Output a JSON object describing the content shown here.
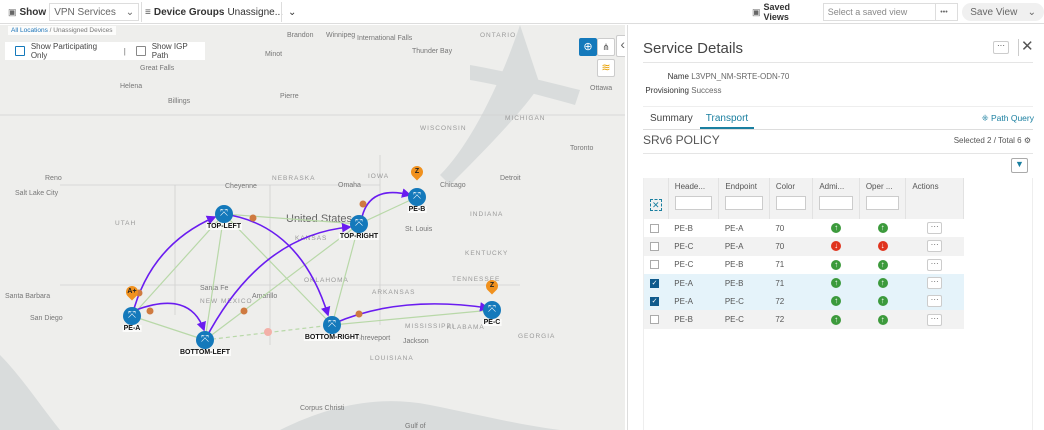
{
  "toolbar": {
    "show_label": "Show",
    "show_value": "VPN Services",
    "device_groups_label": "Device Groups",
    "device_groups_value": "Unassigne...",
    "saved_views_label": "Saved Views",
    "saved_view_placeholder": "Select a saved view",
    "more": "•••",
    "save_view": "Save View"
  },
  "map": {
    "breadcrumb_root": "All Locations",
    "breadcrumb_current": "Unassigned Devices",
    "show_participating": "Show Participating Only",
    "show_igp": "Show IGP Path",
    "country": "United States",
    "labels": [
      "Brandon",
      "Winnipeg",
      "International Falls",
      "Thunder Bay",
      "ONTARIO",
      "Minot",
      "Great Falls",
      "Helena",
      "Billings",
      "Pierre",
      "WISCONSIN",
      "MICHIGAN",
      "Salt Lake City",
      "Cheyenne",
      "Omaha",
      "Chicago",
      "NEBRASKA",
      "IOWA",
      "UTAH",
      "KANSAS",
      "St. Louis",
      "INDIANA",
      "KENTUCKY",
      "TENNESSEE",
      "OKLAHOMA",
      "ARKANSAS",
      "Santa Fe",
      "Amarillo",
      "NEW MEXICO",
      "MISSISSIPPI",
      "ALABAMA",
      "Shreveport",
      "Jackson",
      "LOUISIANA",
      "GEORGIA",
      "Santa Barbara",
      "San Diego",
      "Reno",
      "Corpus Christi",
      "Gulf of",
      "Ottawa",
      "Toronto",
      "Detroit"
    ],
    "nodes": [
      {
        "id": "PE-A"
      },
      {
        "id": "TOP-LEFT"
      },
      {
        "id": "TOP-RIGHT"
      },
      {
        "id": "PE-B"
      },
      {
        "id": "BOTTOM-LEFT"
      },
      {
        "id": "BOTTOM-RIGHT"
      },
      {
        "id": "PE-C"
      }
    ],
    "markers": {
      "a": "A+",
      "z1": "Z",
      "z2": "Z"
    }
  },
  "panel": {
    "title": "Service Details",
    "name_label": "Name",
    "name_value": "L3VPN_NM-SRTE-ODN-70",
    "prov_label": "Provisioning",
    "prov_value": "Success",
    "tabs": [
      "Summary",
      "Transport"
    ],
    "active_tab": "Transport",
    "path_query": "Path Query",
    "section": "SRv6 POLICY",
    "selection": "Selected 2 / Total 6",
    "columns": [
      "Heade...",
      "Endpoint",
      "Color",
      "Admi...",
      "Oper ...",
      "Actions"
    ],
    "rows": [
      {
        "head": "PE-B",
        "end": "PE-A",
        "color": "70",
        "admin": "up",
        "oper": "up",
        "checked": false
      },
      {
        "head": "PE-C",
        "end": "PE-A",
        "color": "70",
        "admin": "down",
        "oper": "down",
        "checked": false
      },
      {
        "head": "PE-C",
        "end": "PE-B",
        "color": "71",
        "admin": "up",
        "oper": "up",
        "checked": false
      },
      {
        "head": "PE-A",
        "end": "PE-B",
        "color": "71",
        "admin": "up",
        "oper": "up",
        "checked": true
      },
      {
        "head": "PE-A",
        "end": "PE-C",
        "color": "72",
        "admin": "up",
        "oper": "up",
        "checked": true
      },
      {
        "head": "PE-B",
        "end": "PE-C",
        "color": "72",
        "admin": "up",
        "oper": "up",
        "checked": false
      }
    ],
    "colors": {
      "up": "#3c9a3c",
      "down": "#e0341e",
      "accent": "#1a7fa0",
      "selected_row": "#e5f3fa",
      "alt_row": "#f2f2f2"
    }
  }
}
